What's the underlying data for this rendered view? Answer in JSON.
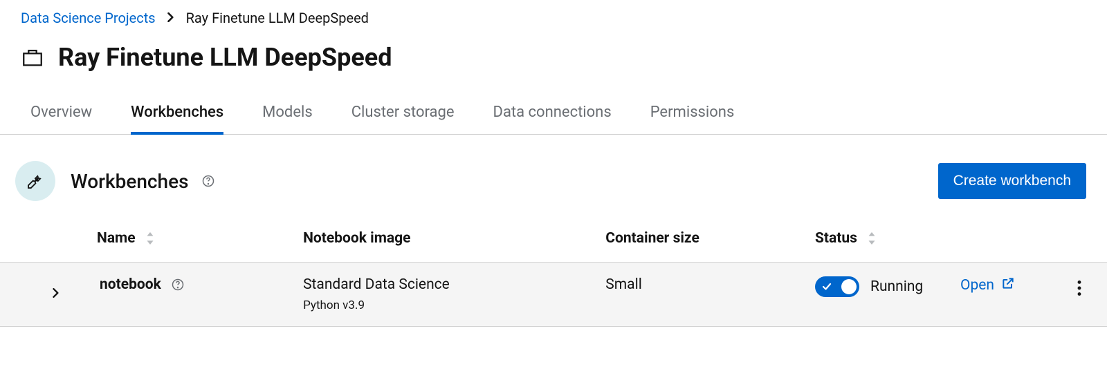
{
  "breadcrumb": {
    "parent": "Data Science Projects",
    "current": "Ray Finetune LLM DeepSpeed"
  },
  "page": {
    "title": "Ray Finetune LLM DeepSpeed"
  },
  "tabs": {
    "overview": "Overview",
    "workbenches": "Workbenches",
    "models": "Models",
    "cluster_storage": "Cluster storage",
    "data_connections": "Data connections",
    "permissions": "Permissions"
  },
  "section": {
    "title": "Workbenches",
    "create_button": "Create workbench"
  },
  "table": {
    "headers": {
      "name": "Name",
      "notebook_image": "Notebook image",
      "container_size": "Container size",
      "status": "Status"
    },
    "rows": [
      {
        "name": "notebook",
        "notebook_image": "Standard Data Science",
        "notebook_image_sub": "Python v3.9",
        "container_size": "Small",
        "status": "Running",
        "open_label": "Open"
      }
    ]
  }
}
